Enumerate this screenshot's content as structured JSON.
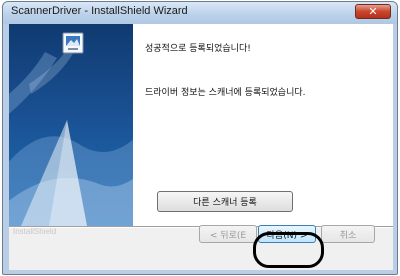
{
  "window": {
    "title": "ScannerDriver - InstallShield Wizard",
    "close_glyph": "✕"
  },
  "side_panel": {
    "icon": "installer-computer-icon"
  },
  "content": {
    "message_success": "성공적으로 등록되었습니다!",
    "message_info": "드라이버 정보는 스캐너에 등록되었습니다.",
    "register_other_button": "다른 스캐너 등록"
  },
  "footer": {
    "brand": "InstallShield",
    "back_button": "< 뒤로(E",
    "next_button": "다음(N) >",
    "cancel_button": "취소"
  },
  "colors": {
    "close_button": "#c9462d",
    "side_panel": "#194e8f",
    "highlight_ring": "#000000"
  }
}
